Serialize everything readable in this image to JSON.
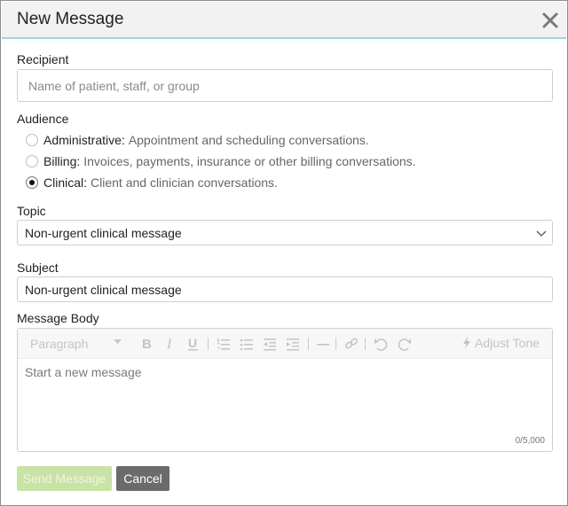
{
  "dialog": {
    "title": "New Message"
  },
  "recipient": {
    "label": "Recipient",
    "placeholder": "Name of patient, staff, or group"
  },
  "audience": {
    "label": "Audience",
    "options": [
      {
        "name": "Administrative:",
        "description": "Appointment and scheduling conversations.",
        "selected": false
      },
      {
        "name": "Billing:",
        "description": "Invoices, payments, insurance or other billing conversations.",
        "selected": false
      },
      {
        "name": "Clinical:",
        "description": "Client and clinician conversations.",
        "selected": true
      }
    ]
  },
  "topic": {
    "label": "Topic",
    "value": "Non-urgent clinical message"
  },
  "subject": {
    "label": "Subject",
    "value": "Non-urgent clinical message"
  },
  "message_body": {
    "label": "Message Body",
    "toolbar": {
      "paragraph_label": "Paragraph",
      "adjust_tone_label": "Adjust Tone",
      "icons": [
        "bold-icon",
        "italic-icon",
        "underline-icon",
        "numbered-list-icon",
        "bulleted-list-icon",
        "outdent-icon",
        "indent-icon",
        "horizontal-rule-icon",
        "link-icon",
        "undo-icon",
        "redo-icon",
        "lightning-icon"
      ]
    },
    "placeholder": "Start a new message",
    "counter": "0/5,000"
  },
  "actions": {
    "send_label": "Send Message",
    "cancel_label": "Cancel"
  },
  "colors": {
    "header_bg": "#f2f2f2",
    "header_accent": "#9fd3e3",
    "send_button_disabled": "#c9e2a6",
    "cancel_button": "#6b6b6b"
  }
}
